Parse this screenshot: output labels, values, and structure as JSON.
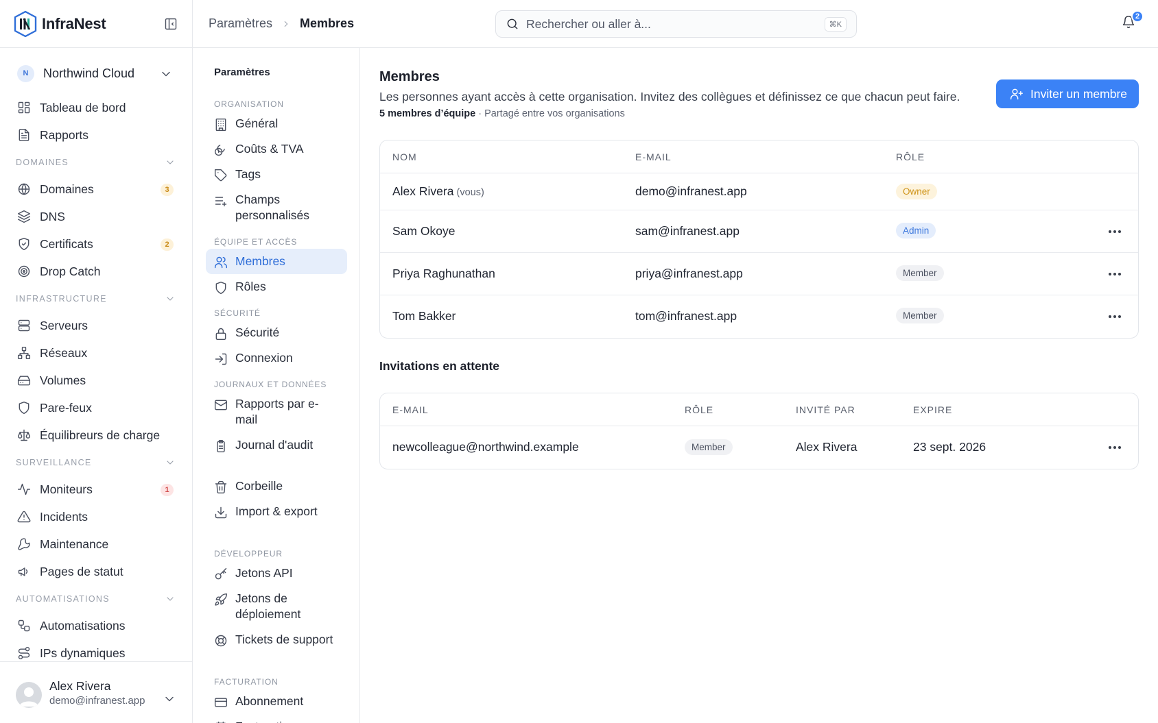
{
  "brand": {
    "name": "InfraNest"
  },
  "org": {
    "initial": "N",
    "name": "Northwind Cloud"
  },
  "sidebar": {
    "top_items": [
      {
        "label": "Tableau de bord",
        "icon": "dashboard-icon"
      },
      {
        "label": "Rapports",
        "icon": "report-icon"
      }
    ],
    "sections": [
      {
        "title": "DOMAINES",
        "items": [
          {
            "label": "Domaines",
            "icon": "globe-icon",
            "badge": "3",
            "badge_color": "amber"
          },
          {
            "label": "DNS",
            "icon": "layers-icon"
          },
          {
            "label": "Certificats",
            "icon": "shield-check-icon",
            "badge": "2",
            "badge_color": "amber"
          },
          {
            "label": "Drop Catch",
            "icon": "target-icon"
          }
        ]
      },
      {
        "title": "INFRASTRUCTURE",
        "items": [
          {
            "label": "Serveurs",
            "icon": "server-icon"
          },
          {
            "label": "Réseaux",
            "icon": "network-icon"
          },
          {
            "label": "Volumes",
            "icon": "drive-icon"
          },
          {
            "label": "Pare-feux",
            "icon": "shield-icon"
          },
          {
            "label": "Équilibreurs de charge",
            "icon": "scale-icon"
          }
        ]
      },
      {
        "title": "SURVEILLANCE",
        "items": [
          {
            "label": "Moniteurs",
            "icon": "activity-icon",
            "badge": "1",
            "badge_color": "red"
          },
          {
            "label": "Incidents",
            "icon": "alert-triangle-icon"
          },
          {
            "label": "Maintenance",
            "icon": "wrench-icon"
          },
          {
            "label": "Pages de statut",
            "icon": "megaphone-icon"
          }
        ]
      },
      {
        "title": "AUTOMATISATIONS",
        "items": [
          {
            "label": "Automatisations",
            "icon": "workflow-icon"
          },
          {
            "label": "IPs dynamiques",
            "icon": "route-icon"
          }
        ]
      }
    ]
  },
  "user": {
    "name": "Alex Rivera",
    "email": "demo@infranest.app"
  },
  "topbar": {
    "breadcrumb": [
      "Paramètres",
      "Membres"
    ],
    "search_placeholder": "Rechercher ou aller à...",
    "search_shortcut": "⌘K",
    "notifications_count": "2"
  },
  "settings_nav": {
    "title": "Paramètres",
    "sections": [
      {
        "title": "ORGANISATION",
        "items": [
          {
            "label": "Général",
            "icon": "building-icon"
          },
          {
            "label": "Coûts & TVA",
            "icon": "coins-icon"
          },
          {
            "label": "Tags",
            "icon": "tag-icon"
          },
          {
            "label": "Champs personnalisés",
            "icon": "list-plus-icon"
          }
        ]
      },
      {
        "title": "ÉQUIPE ET ACCÈS",
        "items": [
          {
            "label": "Membres",
            "icon": "users-icon",
            "active": true
          },
          {
            "label": "Rôles",
            "icon": "shield-icon"
          }
        ]
      },
      {
        "title": "SÉCURITÉ",
        "items": [
          {
            "label": "Sécurité",
            "icon": "lock-icon"
          },
          {
            "label": "Connexion",
            "icon": "login-icon"
          }
        ]
      },
      {
        "title": "JOURNAUX ET DONNÉES",
        "items": [
          {
            "label": "Rapports par e-mail",
            "icon": "mail-icon"
          },
          {
            "label": "Journal d'audit",
            "icon": "clipboard-icon"
          },
          {
            "label": "Corbeille",
            "icon": "trash-icon"
          },
          {
            "label": "Import & export",
            "icon": "download-icon"
          }
        ]
      },
      {
        "title": "DÉVELOPPEUR",
        "items": [
          {
            "label": "Jetons API",
            "icon": "key-icon"
          },
          {
            "label": "Jetons de déploiement",
            "icon": "rocket-icon"
          },
          {
            "label": "Tickets de support",
            "icon": "lifebuoy-icon"
          }
        ]
      },
      {
        "title": "FACTURATION",
        "items": [
          {
            "label": "Abonnement",
            "icon": "credit-card-icon"
          },
          {
            "label": "Facturation",
            "icon": "receipt-icon"
          }
        ]
      }
    ]
  },
  "main": {
    "title": "Membres",
    "description": "Les personnes ayant accès à cette organisation. Invitez des collègues et définissez ce que chacun peut faire.",
    "count_bold": "5 membres d’équipe",
    "count_rest": " · Partagé entre vos organisations",
    "invite_label": "Inviter un membre",
    "members_table": {
      "headers": [
        "NOM",
        "E-MAIL",
        "RÔLE"
      ],
      "rows": [
        {
          "name": "Alex Rivera",
          "suffix": "(vous)",
          "email": "demo@infranest.app",
          "role": "Owner",
          "role_style": "owner",
          "menu": false
        },
        {
          "name": "Sam Okoye",
          "email": "sam@infranest.app",
          "role": "Admin",
          "role_style": "admin",
          "menu": true
        },
        {
          "name": "Priya Raghunathan",
          "email": "priya@infranest.app",
          "role": "Member",
          "role_style": "member",
          "menu": true
        },
        {
          "name": "Tom Bakker",
          "email": "tom@infranest.app",
          "role": "Member",
          "role_style": "member",
          "menu": true
        }
      ]
    },
    "pending_title": "Invitations en attente",
    "pending_table": {
      "headers": [
        "E-MAIL",
        "RÔLE",
        "INVITÉ PAR",
        "EXPIRE"
      ],
      "rows": [
        {
          "email": "newcolleague@northwind.example",
          "role": "Member",
          "invited_by": "Alex Rivera",
          "expires": "23 sept. 2026"
        }
      ]
    }
  },
  "colors": {
    "accent": "#3b82f6",
    "active_bg": "#e6eefb",
    "owner": "#cf9419",
    "admin": "#3d78dd"
  }
}
